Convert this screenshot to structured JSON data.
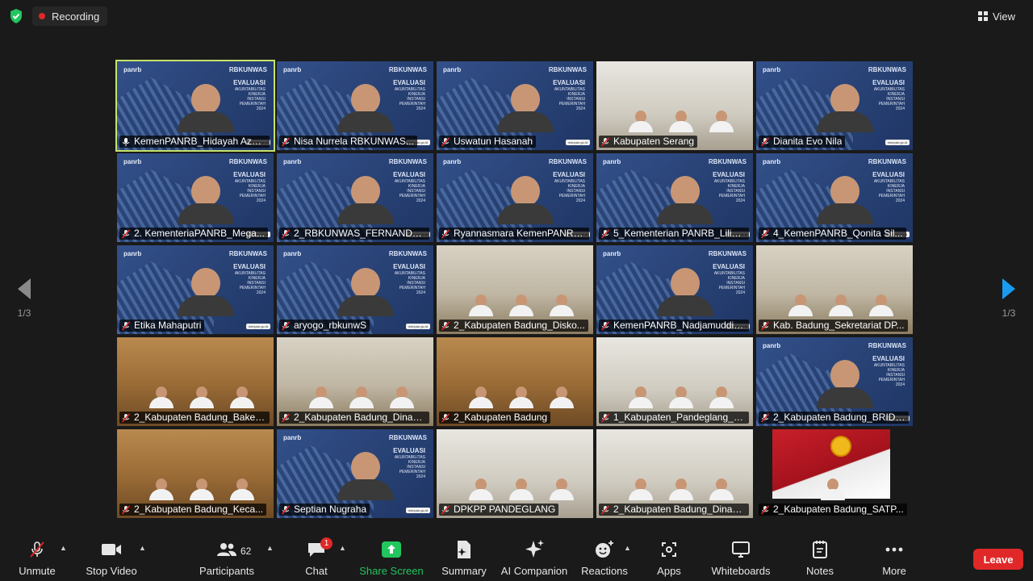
{
  "topbar": {
    "recording_label": "Recording",
    "view_label": "View"
  },
  "pager": {
    "left": "1/3",
    "right": "1/3"
  },
  "tiles": [
    {
      "name": "KemenPANRB_Hidayah Azm...",
      "bg": "slide",
      "active": true,
      "mic": "unmuted"
    },
    {
      "name": "Nisa Nurrela RBKUNWAS...",
      "bg": "slide",
      "mic": "muted"
    },
    {
      "name": "Uswatun Hasanah",
      "bg": "slide",
      "mic": "muted"
    },
    {
      "name": "Kabupaten Serang",
      "bg": "office",
      "mic": "muted"
    },
    {
      "name": "Dianita Evo Nila",
      "bg": "slide",
      "mic": "muted"
    },
    {
      "name": "2. KementeriaPANRB_Mega...",
      "bg": "slide",
      "mic": "muted"
    },
    {
      "name": "2_RBKUNWAS_FERNANDO S...",
      "bg": "slide",
      "mic": "muted"
    },
    {
      "name": "Ryannasmara KemenPANRB ...",
      "bg": "slide",
      "mic": "muted"
    },
    {
      "name": "5_Kementerian PANRB_Lilist...",
      "bg": "slide",
      "mic": "muted"
    },
    {
      "name": "4_KemenPANRB_Qonita Sil...",
      "bg": "slide",
      "mic": "muted"
    },
    {
      "name": "Etika Mahaputri",
      "bg": "slide",
      "mic": "muted"
    },
    {
      "name": "aryogo_rbkunwS",
      "bg": "slide",
      "mic": "muted"
    },
    {
      "name": "2_Kabupaten Badung_Disko...",
      "bg": "room",
      "mic": "muted"
    },
    {
      "name": "KemenPANRB_Nadjamuddin...",
      "bg": "slide",
      "mic": "muted"
    },
    {
      "name": "Kab. Badung_Sekretariat DP...",
      "bg": "room",
      "mic": "muted"
    },
    {
      "name": "2_Kabupaten Badung_Bakes...",
      "bg": "wood",
      "mic": "muted"
    },
    {
      "name": "2_Kabupaten Badung_Dinas ...",
      "bg": "room",
      "mic": "muted"
    },
    {
      "name": "2_Kabupaten Badung",
      "bg": "wood",
      "mic": "muted"
    },
    {
      "name": "1_Kabupaten_Pandeglang_S...",
      "bg": "office",
      "mic": "muted"
    },
    {
      "name": "2_Kabupaten Badung_BRIDA...",
      "bg": "slide",
      "mic": "muted"
    },
    {
      "name": "2_Kabupaten Badung_Keca...",
      "bg": "wood",
      "mic": "muted"
    },
    {
      "name": "Septian Nugraha",
      "bg": "slide",
      "mic": "muted"
    },
    {
      "name": "DPKPP PANDEGLANG",
      "bg": "office",
      "mic": "muted"
    },
    {
      "name": "2_Kabupaten Badung_Dinas ...",
      "bg": "office",
      "mic": "muted"
    },
    {
      "name": "2_Kabupaten Badung_SATP...",
      "bg": "red",
      "mic": "muted"
    }
  ],
  "slide": {
    "logo": "panrb",
    "rbk": "RBKUNWAS",
    "eval_title": "EVALUASI",
    "eval_lines": [
      "AKUNTABILITAS",
      "KINERJA",
      "INSTANSI",
      "PEMERINTAH",
      "2024"
    ],
    "site": "menpan.go.id"
  },
  "toolbar": {
    "unmute": "Unmute",
    "stop_video": "Stop Video",
    "participants": "Participants",
    "participants_count": "62",
    "chat": "Chat",
    "chat_badge": "1",
    "share_screen": "Share Screen",
    "summary": "Summary",
    "ai_companion": "AI Companion",
    "reactions": "Reactions",
    "apps": "Apps",
    "whiteboards": "Whiteboards",
    "notes": "Notes",
    "more": "More",
    "leave": "Leave"
  },
  "colors": {
    "accent_green": "#22c55e",
    "active_speaker": "#c6e26a",
    "leave_red": "#e02828",
    "pager_blue": "#1a9bf0"
  }
}
